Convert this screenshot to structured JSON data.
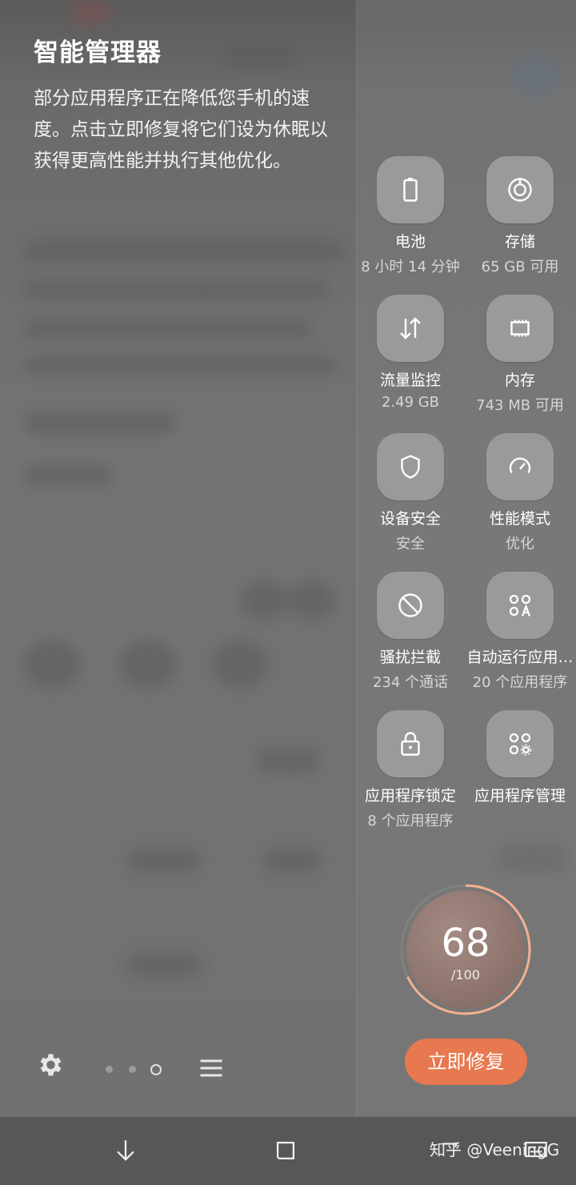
{
  "title": "智能管理器",
  "description": "部分应用程序正在降低您手机的速度。点击立即修复将它们设为休眠以获得更高性能并执行其他优化。",
  "tiles": [
    {
      "label": "电池",
      "sub": "8 小时 14 分钟",
      "icon": "battery-icon"
    },
    {
      "label": "存储",
      "sub": "65 GB 可用",
      "icon": "storage-icon"
    },
    {
      "label": "流量监控",
      "sub": "2.49 GB",
      "icon": "data-usage-icon"
    },
    {
      "label": "内存",
      "sub": "743 MB 可用",
      "icon": "memory-icon"
    },
    {
      "label": "设备安全",
      "sub": "安全",
      "icon": "shield-icon"
    },
    {
      "label": "性能模式",
      "sub": "优化",
      "icon": "speedometer-icon"
    },
    {
      "label": "骚扰拦截",
      "sub": "234 个通话",
      "icon": "block-icon"
    },
    {
      "label": "自动运行应用…",
      "sub": "20 个应用程序",
      "icon": "auto-run-apps-icon"
    },
    {
      "label": "应用程序锁定",
      "sub": "8 个应用程序",
      "icon": "lock-icon"
    },
    {
      "label": "应用程序管理",
      "sub": "",
      "icon": "app-management-icon"
    }
  ],
  "score": {
    "value": "68",
    "max": "/100",
    "progress": 0.68
  },
  "fix_button": "立即修复",
  "pager": {
    "count": 3,
    "current": 2
  },
  "watermark": "知乎 @VeeningG",
  "colors": {
    "accent": "#e8784f",
    "ring": "#f4b08f"
  }
}
